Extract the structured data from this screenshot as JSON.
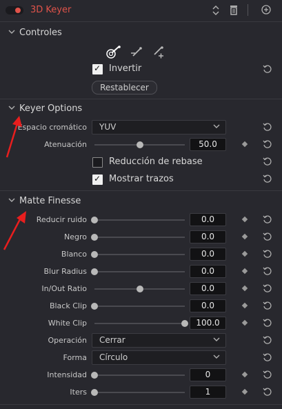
{
  "header": {
    "title": "3D Keyer"
  },
  "controles": {
    "title": "Controles",
    "invertir_label": "Invertir",
    "restablecer_label": "Restablecer"
  },
  "keyer_options": {
    "title": "Keyer Options",
    "espacio_label": "Espacio cromático",
    "espacio_value": "YUV",
    "atenuacion_label": "Atenuación",
    "atenuacion_value": "50.0",
    "atenuacion_level": 0.5,
    "reduccion_label": "Reducción de rebase",
    "reduccion_checked": false,
    "mostrar_label": "Mostrar trazos",
    "mostrar_checked": true
  },
  "matte_finesse": {
    "title": "Matte Finesse",
    "rows": [
      {
        "label": "Reducir ruido",
        "value": "0.0",
        "level": 0
      },
      {
        "label": "Negro",
        "value": "0.0",
        "level": 0
      },
      {
        "label": "Blanco",
        "value": "0.0",
        "level": 0
      },
      {
        "label": "Blur Radius",
        "value": "0.0",
        "level": 0
      },
      {
        "label": "In/Out Ratio",
        "value": "0.0",
        "level": 0.5
      },
      {
        "label": "Black Clip",
        "value": "0.0",
        "level": 0
      },
      {
        "label": "White Clip",
        "value": "100.0",
        "level": 1
      }
    ],
    "operacion_label": "Operación",
    "operacion_value": "Cerrar",
    "forma_label": "Forma",
    "forma_value": "Círculo",
    "intensidad_label": "Intensidad",
    "intensidad_value": "0",
    "intensidad_level": 0,
    "iters_label": "Iters",
    "iters_value": "1",
    "iters_level": 0
  },
  "colors": {
    "background": "#28282e",
    "accent_red": "#e0534a",
    "annotation_arrow": "#e81e1e"
  }
}
